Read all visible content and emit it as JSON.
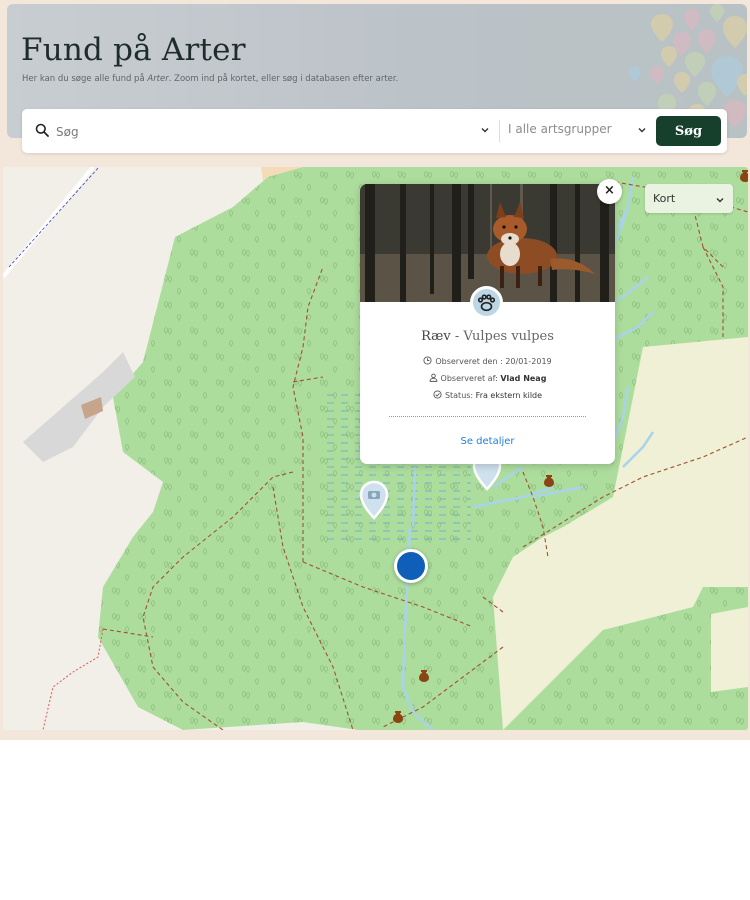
{
  "header": {
    "title": "Fund på Arter",
    "subtitle_before": "Her kan du søge alle fund på ",
    "subtitle_em": "Arter",
    "subtitle_after": ". Zoom ind på kortet, eller søg i databasen efter arter."
  },
  "search": {
    "placeholder": "Søg",
    "group_label": "I alle artsgrupper",
    "button_label": "Søg"
  },
  "map": {
    "layer_label": "Kort",
    "colors": {
      "forest": "#addd9d",
      "background": "#f2efe9",
      "farmland": "#eff0d6",
      "water": "#a9d3ea",
      "path": "#a0522d"
    }
  },
  "popup": {
    "close_label": "×",
    "species_common": "Ræv",
    "species_separator": " - ",
    "species_latin": "Vulpes vulpes",
    "observed_date_label": "Observeret den : ",
    "observed_date": "20/01-2019",
    "observed_by_label": "Observeret af: ",
    "observed_by": "Vlad Neag",
    "status_label": "Status: ",
    "status": "Fra ekstern kilde",
    "details_link": "Se detaljer",
    "badge_icon": "paw-icon"
  },
  "icons": {
    "search": "search-icon",
    "chevron": "chevron-down-icon",
    "close": "close-icon",
    "camera_pin": "camera-pin-icon",
    "location": "current-location-icon",
    "archaeology": "archaeological-site-icon"
  }
}
